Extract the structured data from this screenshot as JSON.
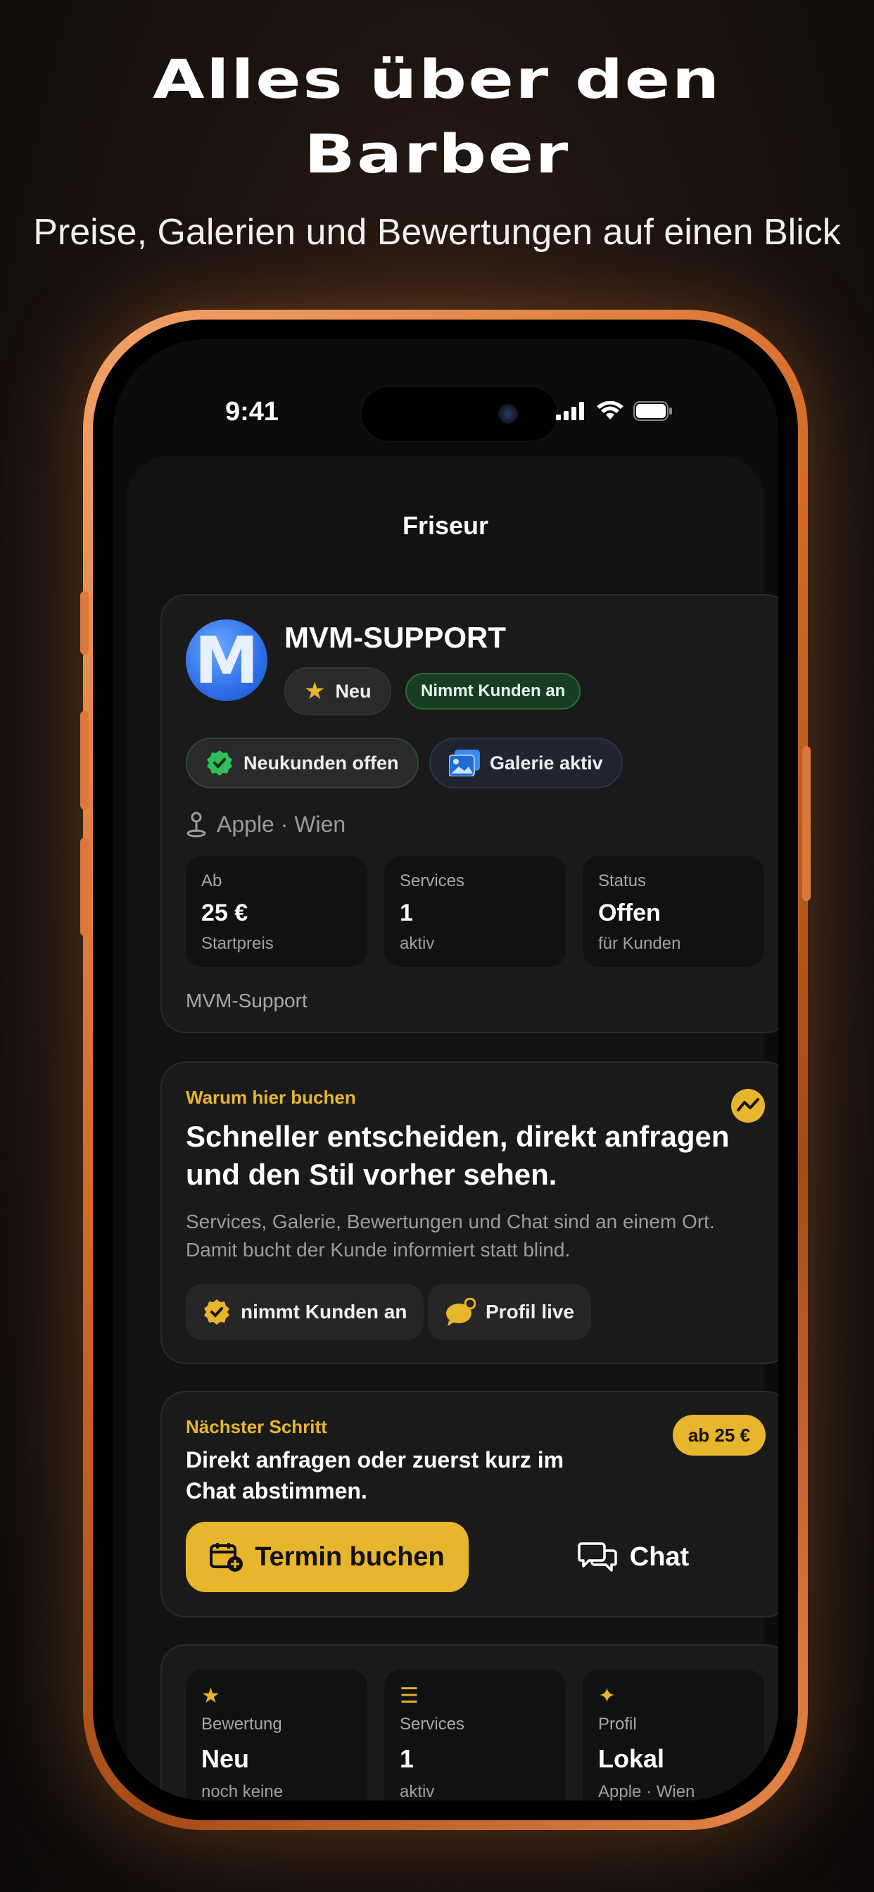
{
  "hero": {
    "title_line1": "Alles über den",
    "title_line2": "Barber",
    "subtitle": "Preise, Galerien und Bewertungen auf einen Blick"
  },
  "status_bar": {
    "time": "9:41"
  },
  "nav": {
    "title": "Friseur"
  },
  "profile": {
    "avatar_letter": "M",
    "name": "MVM-SUPPORT",
    "rating_chip": "Neu",
    "status_badge": "Nimmt Kunden an",
    "chip_new_customers": "Neukunden offen",
    "chip_gallery": "Galerie aktiv",
    "location": "Apple · Wien",
    "stats": [
      {
        "label": "Ab",
        "value": "25 €",
        "sub": "Startpreis"
      },
      {
        "label": "Services",
        "value": "1",
        "sub": "aktiv"
      },
      {
        "label": "Status",
        "value": "Offen",
        "sub": "für Kunden"
      }
    ],
    "footer": "MVM-Support"
  },
  "why": {
    "eyebrow": "Warum hier buchen",
    "headline": "Schneller entscheiden, direkt anfragen und den Stil vorher sehen.",
    "body": "Services, Galerie, Bewertungen und Chat sind an einem Ort. Damit bucht der Kunde informiert statt blind.",
    "pill_accepting": "nimmt Kunden an",
    "pill_live": "Profil live"
  },
  "next": {
    "eyebrow": "Nächster Schritt",
    "text": "Direkt anfragen oder zuerst kurz im Chat abstimmen.",
    "price": "ab 25 €",
    "book_label": "Termin buchen",
    "chat_label": "Chat"
  },
  "summary": [
    {
      "icon": "star-icon",
      "label": "Bewertung",
      "value": "Neu",
      "sub": "noch keine"
    },
    {
      "icon": "list-icon",
      "label": "Services",
      "value": "1",
      "sub": "aktiv"
    },
    {
      "icon": "sparkle-icon",
      "label": "Profil",
      "value": "Lokal",
      "sub": "Apple · Wien"
    }
  ],
  "colors": {
    "accent": "#e8b62c",
    "frame": "#d46a26",
    "success": "#2fbf5a"
  }
}
